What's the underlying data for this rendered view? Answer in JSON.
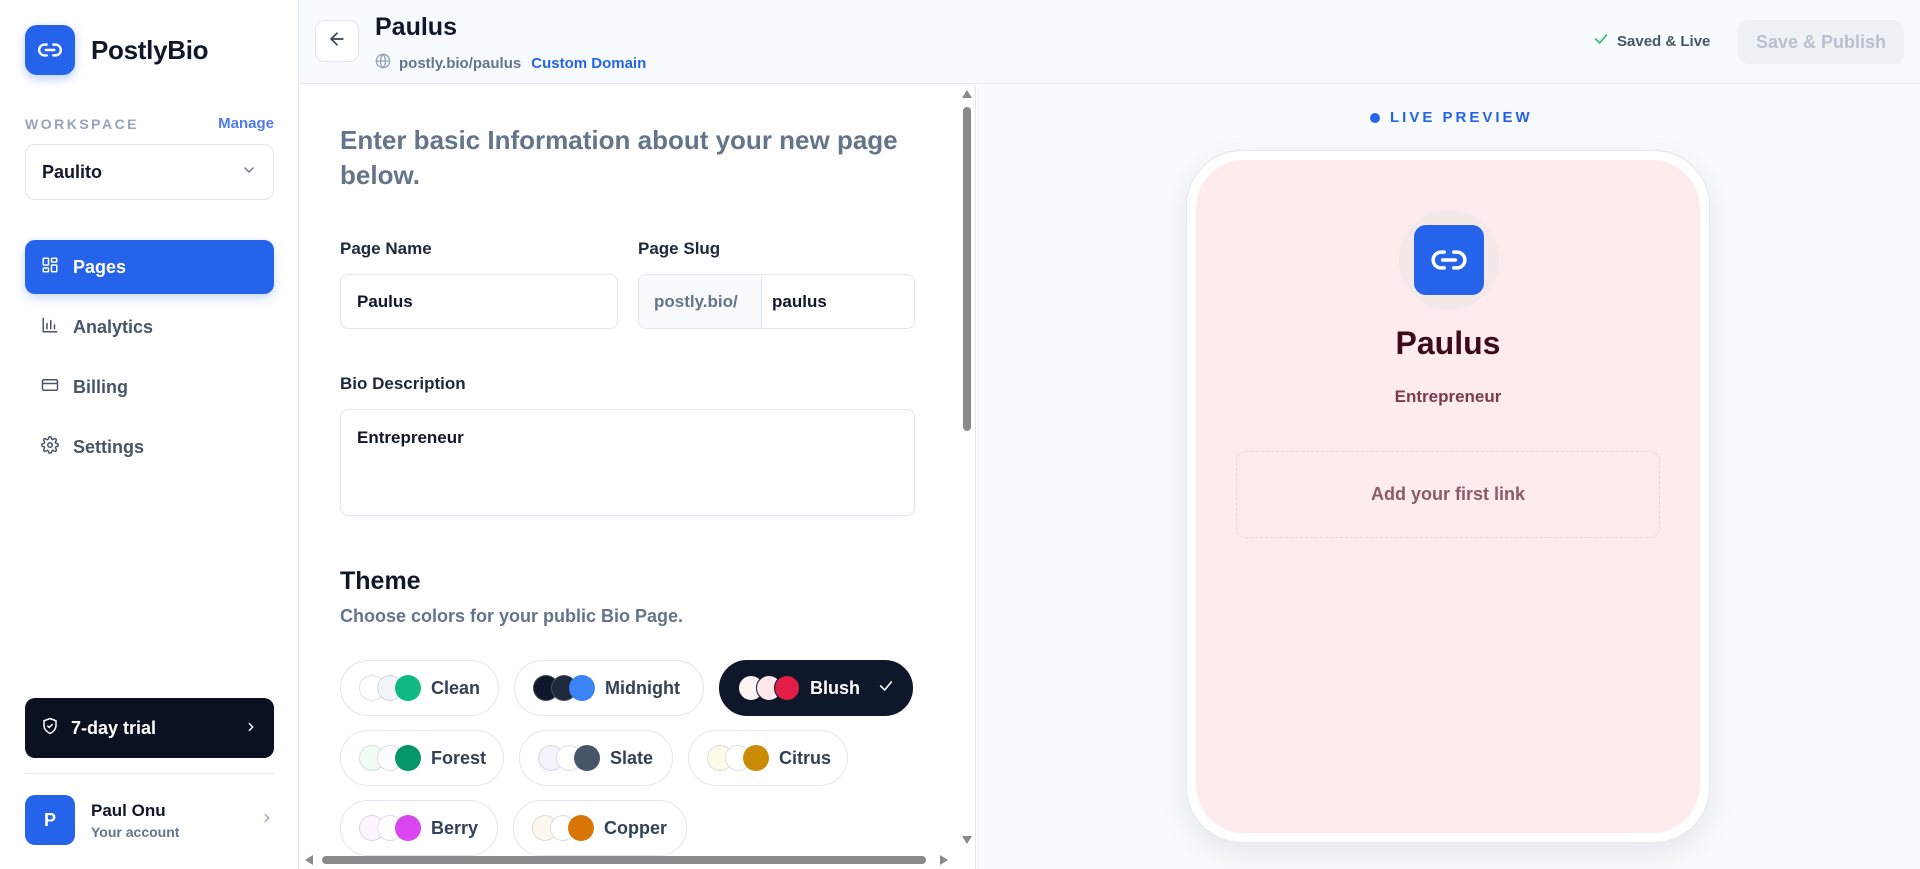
{
  "sidebar": {
    "brand_name": "PostlyBio",
    "workspace_label": "WORKSPACE",
    "manage_label": "Manage",
    "workspace_value": "Paulito",
    "nav": [
      {
        "label": "Pages",
        "icon": "grid-icon",
        "active": true
      },
      {
        "label": "Analytics",
        "icon": "bar-chart-icon",
        "active": false
      },
      {
        "label": "Billing",
        "icon": "credit-card-icon",
        "active": false
      },
      {
        "label": "Settings",
        "icon": "gear-icon",
        "active": false
      }
    ],
    "trial_label": "7-day trial",
    "account": {
      "initial": "P",
      "name": "Paul Onu",
      "subtitle": "Your account"
    }
  },
  "header": {
    "title": "Paulus",
    "url": "postly.bio/paulus",
    "custom_domain_label": "Custom Domain",
    "saved_label": "Saved & Live",
    "publish_label": "Save & Publish"
  },
  "form": {
    "intro": "Enter basic Information about your new page below.",
    "page_name_label": "Page Name",
    "page_name_value": "Paulus",
    "slug_label": "Page Slug",
    "slug_prefix": "postly.bio/",
    "slug_value": "paulus",
    "bio_label": "Bio Description",
    "bio_value": "Entrepreneur",
    "theme_title": "Theme",
    "theme_subtitle": "Choose colors for your public Bio Page.",
    "themes": [
      {
        "name": "Clean",
        "colors": [
          "#ffffff",
          "#f1f5f9",
          "#10b981"
        ],
        "selected": false
      },
      {
        "name": "Midnight",
        "colors": [
          "#0f172a",
          "#1e293b",
          "#3b82f6"
        ],
        "selected": false
      },
      {
        "name": "Blush",
        "colors": [
          "#fdf2f4",
          "#fce7eb",
          "#e11d48"
        ],
        "selected": true
      },
      {
        "name": "Forest",
        "colors": [
          "#f0fdf4",
          "#ffffff",
          "#059669"
        ],
        "selected": false
      },
      {
        "name": "Slate",
        "colors": [
          "#f1f5f9",
          "#ffffff",
          "#475569"
        ],
        "selected": false
      },
      {
        "name": "Citrus",
        "colors": [
          "#fefce8",
          "#ffffff",
          "#ca8a04"
        ],
        "selected": false
      },
      {
        "name": "Berry",
        "colors": [
          "#fdf4ff",
          "#ffffff",
          "#d946ef"
        ],
        "selected": false
      },
      {
        "name": "Copper",
        "colors": [
          "#fff7ed",
          "#ffffff",
          "#d97706"
        ],
        "selected": false
      }
    ]
  },
  "preview": {
    "label": "LIVE PREVIEW",
    "name": "Paulus",
    "bio": "Entrepreneur",
    "add_link_label": "Add your first link"
  },
  "colors": {
    "accent": "#2563eb",
    "preview_bg": "#fdeceb",
    "dark": "#0b1120"
  }
}
